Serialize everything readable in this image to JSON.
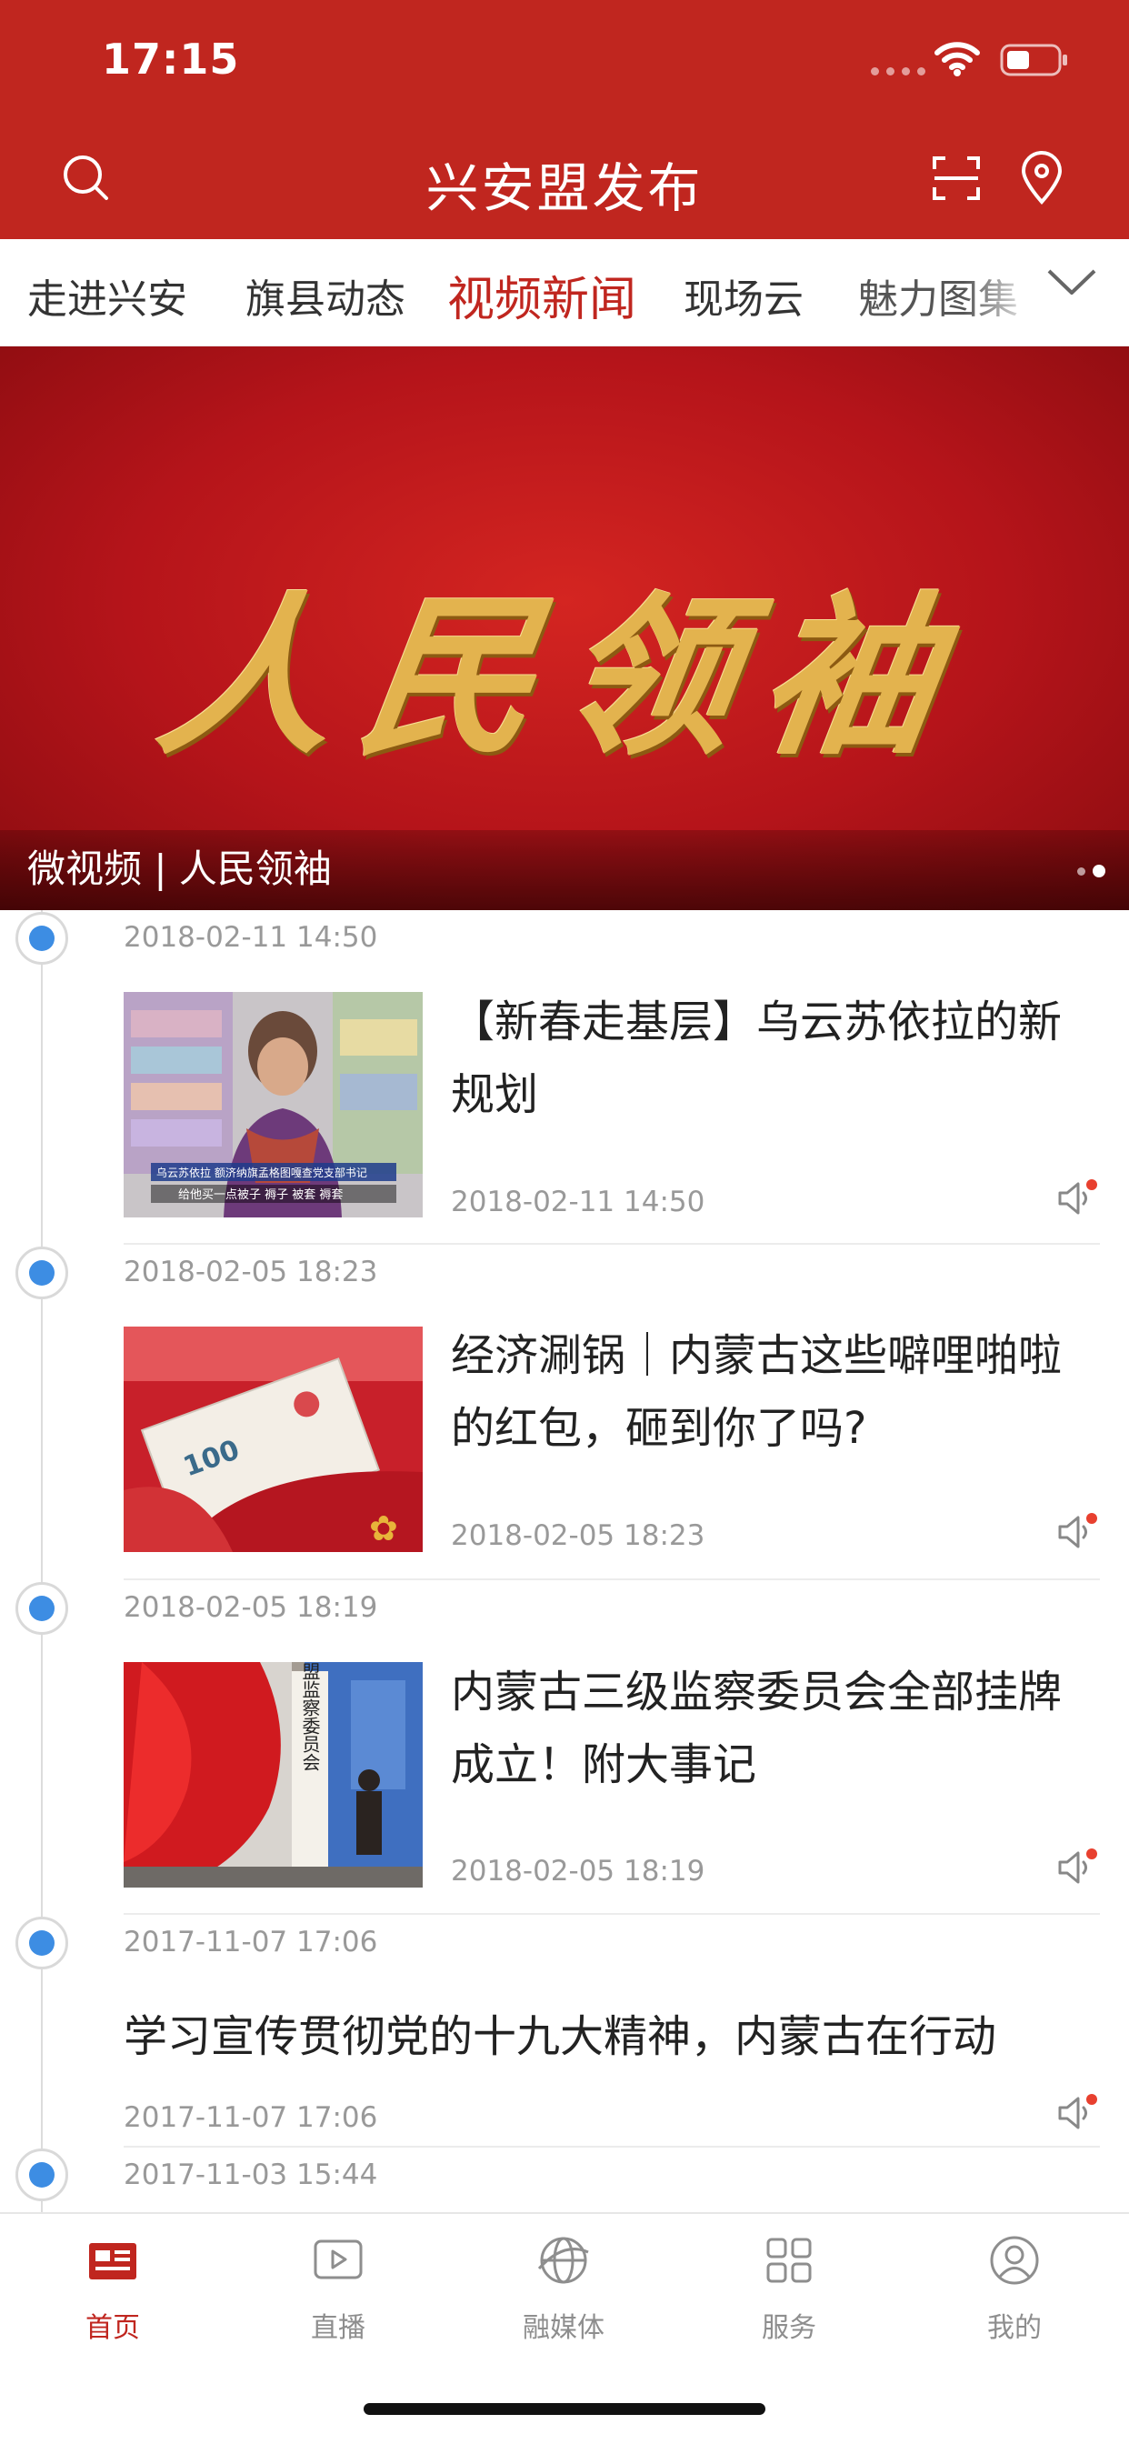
{
  "status_bar": {
    "time": "17:15"
  },
  "header": {
    "title": "兴安盟发布"
  },
  "tabs": [
    {
      "label": "走进兴安"
    },
    {
      "label": "旗县动态"
    },
    {
      "label": "视频新闻"
    },
    {
      "label": "现场云"
    },
    {
      "label": "魅力图集"
    }
  ],
  "banner": {
    "calligraphy": "人民领袖",
    "caption": "微视频 | 人民领袖"
  },
  "timeline": [
    {
      "time": "2018-02-11 14:50",
      "title": "【新春走基层】乌云苏依拉的新规划",
      "date": "2018-02-11 14:50",
      "thumb_caption_1": "乌云苏依拉 额济纳旗孟格图嘎查党支部书记",
      "thumb_caption_2": "给他买一点被子 褥子 被套 褥套"
    },
    {
      "time": "2018-02-05 18:23",
      "title": "经济涮锅｜内蒙古这些噼哩啪啦的红包，砸到你了吗?",
      "date": "2018-02-05 18:23"
    },
    {
      "time": "2018-02-05 18:19",
      "title": "内蒙古三级监察委员会全部挂牌成立！附大事记",
      "date": "2018-02-05 18:19",
      "sign_text": "阿拉善盟监察委员会"
    },
    {
      "time": "2017-11-07 17:06",
      "title": "学习宣传贯彻党的十九大精神，内蒙古在行动",
      "date": "2017-11-07 17:06"
    },
    {
      "time": "2017-11-03 15:44"
    }
  ],
  "bottom_nav": [
    {
      "label": "首页"
    },
    {
      "label": "直播"
    },
    {
      "label": "融媒体"
    },
    {
      "label": "服务"
    },
    {
      "label": "我的"
    }
  ],
  "colors": {
    "brand_red": "#c0261f",
    "timeline_blue": "#3d8de3",
    "gold": "#e3b34e"
  },
  "icons": [
    "search-icon",
    "scan-icon",
    "location-pin-icon",
    "chevron-down-icon",
    "speaker-icon",
    "home-news-icon",
    "live-play-icon",
    "media-globe-icon",
    "services-grid-icon",
    "profile-icon"
  ]
}
